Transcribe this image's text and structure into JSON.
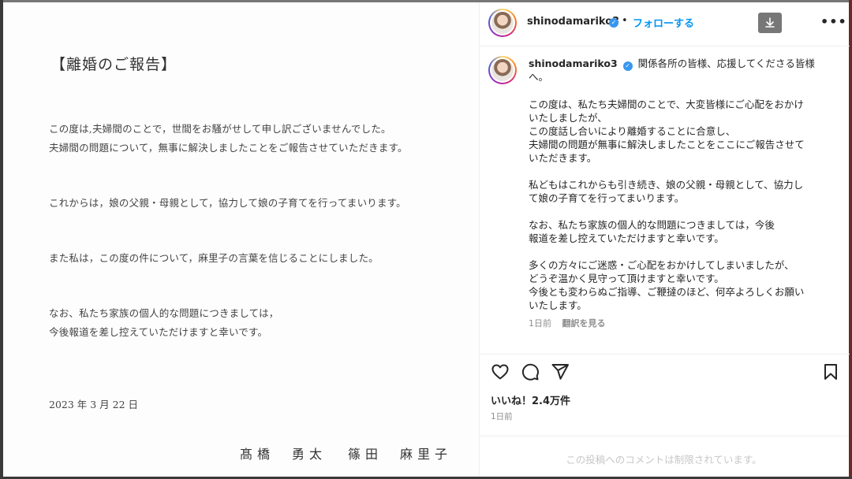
{
  "letter": {
    "title": "【離婚のご報告】",
    "lines": [
      "この度は,夫婦間のことで，世間をお騒がせして申し訳ございませんでした。",
      "夫婦間の問題について，無事に解決しましたことをご報告させていただきます。",
      "これからは，娘の父親・母親として，協力して娘の子育てを行ってまいります。",
      "また私は，この度の件について，麻里子の言葉を信じることにしました。",
      "なお、私たち家族の個人的な問題につきましては，",
      "今後報道を差し控えていただけますと幸いです。"
    ],
    "date": "2023 年 3 月 22 日",
    "signature_1": "髙橋　勇太",
    "signature_2": "篠田　麻里子"
  },
  "post": {
    "username": "shinodamariko3",
    "verified_glyph": "✓",
    "dot": "•",
    "follow_label": "フォローする",
    "download_icon": "download-icon",
    "more_label": "•••",
    "caption": {
      "username": "shinodamariko3",
      "intro": "関係各所の皆様、応援してくださる皆様",
      "intro_2": "へ。",
      "p1": [
        "この度は、私たち夫婦間のことで、大変皆様にご心配をおかけ",
        "いたしましたが、",
        "この度話し合いにより離婚することに合意し、",
        "夫婦間の問題が無事に解決しましたことをここにご報告させて",
        "いただきます。"
      ],
      "p2": [
        "私どもはこれからも引き続き、娘の父親・母親として、協力し",
        "て娘の子育てを行ってまいります。"
      ],
      "p3": [
        "なお、私たち家族の個人的な問題につきましては，今後",
        "報道を差し控えていただけますと幸いです。"
      ],
      "p4": [
        "多くの方々にご迷惑・ご心配をおかけしてしまいましたが、",
        "どうぞ温かく見守って頂けますと幸いです。",
        "今後とも変わらぬご指導、ご鞭撻のほど、何卒よろしくお願い",
        "いたします。"
      ]
    },
    "caption_time": "1日前",
    "translate_label": "翻訳を見る",
    "likes": "いいね！2.4万件",
    "time_ago": "1日前",
    "comments_restricted": "この投稿へのコメントは制限されています。"
  },
  "icons": [
    "heart-icon",
    "comment-icon",
    "share-icon",
    "bookmark-icon",
    "download-icon"
  ],
  "colors": {
    "link": "#0095f6",
    "verified": "#3897f0",
    "muted": "#8e8e8e",
    "text": "#262626"
  }
}
